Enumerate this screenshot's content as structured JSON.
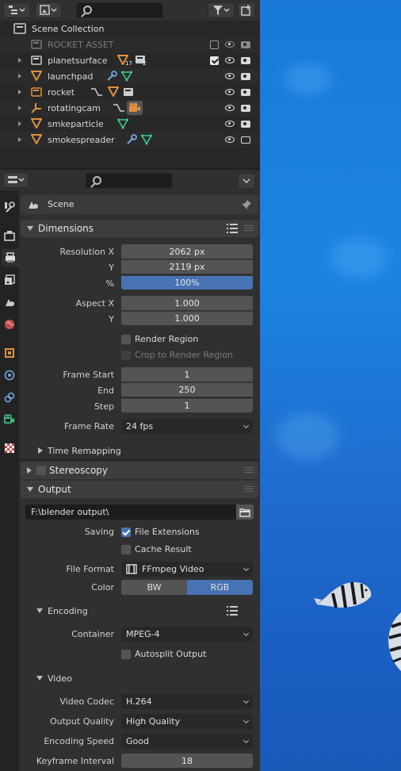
{
  "outliner": {
    "scene_collection": "Scene Collection",
    "items": [
      {
        "label": "ROCKET ASSET"
      },
      {
        "label": "planetsurface",
        "badge1": "17",
        "badge2": "2"
      },
      {
        "label": "launchpad"
      },
      {
        "label": "rocket"
      },
      {
        "label": "rotatingcam"
      },
      {
        "label": "smkeparticle"
      },
      {
        "label": "smokespreader"
      }
    ]
  },
  "context": {
    "scene_label": "Scene"
  },
  "dimensions": {
    "title": "Dimensions",
    "resolution_x_label": "Resolution X",
    "resolution_x": "2062 px",
    "y_label": "Y",
    "resolution_y": "2119 px",
    "percent_label": "%",
    "percent": "100%",
    "aspect_x_label": "Aspect X",
    "aspect_x": "1.000",
    "aspect_y_label": "Y",
    "aspect_y": "1.000",
    "render_region": "Render Region",
    "crop_region": "Crop to Render Region",
    "frame_start_label": "Frame Start",
    "frame_start": "1",
    "end_label": "End",
    "frame_end": "250",
    "step_label": "Step",
    "frame_step": "1",
    "frame_rate_label": "Frame Rate",
    "frame_rate": "24 fps",
    "time_remapping": "Time Remapping"
  },
  "stereoscopy": {
    "title": "Stereoscopy"
  },
  "output": {
    "title": "Output",
    "path": "F:\\blender output\\",
    "saving_label": "Saving",
    "file_extensions": "File Extensions",
    "cache_result": "Cache Result",
    "file_format_label": "File Format",
    "file_format": "FFmpeg Video",
    "color_label": "Color",
    "color_bw": "BW",
    "color_rgb": "RGB"
  },
  "encoding": {
    "title": "Encoding",
    "container_label": "Container",
    "container": "MPEG-4",
    "autosplit": "Autosplit Output"
  },
  "video": {
    "title": "Video",
    "codec_label": "Video Codec",
    "codec": "H.264",
    "quality_label": "Output Quality",
    "quality": "High Quality",
    "speed_label": "Encoding Speed",
    "speed": "Good",
    "keyframe_label": "Keyframe Interval",
    "keyframe": "18"
  },
  "colors": {
    "accent": "#4772b3",
    "mesh": "#e09040",
    "data": "#41c98a",
    "modifier": "#6fa6e0"
  }
}
